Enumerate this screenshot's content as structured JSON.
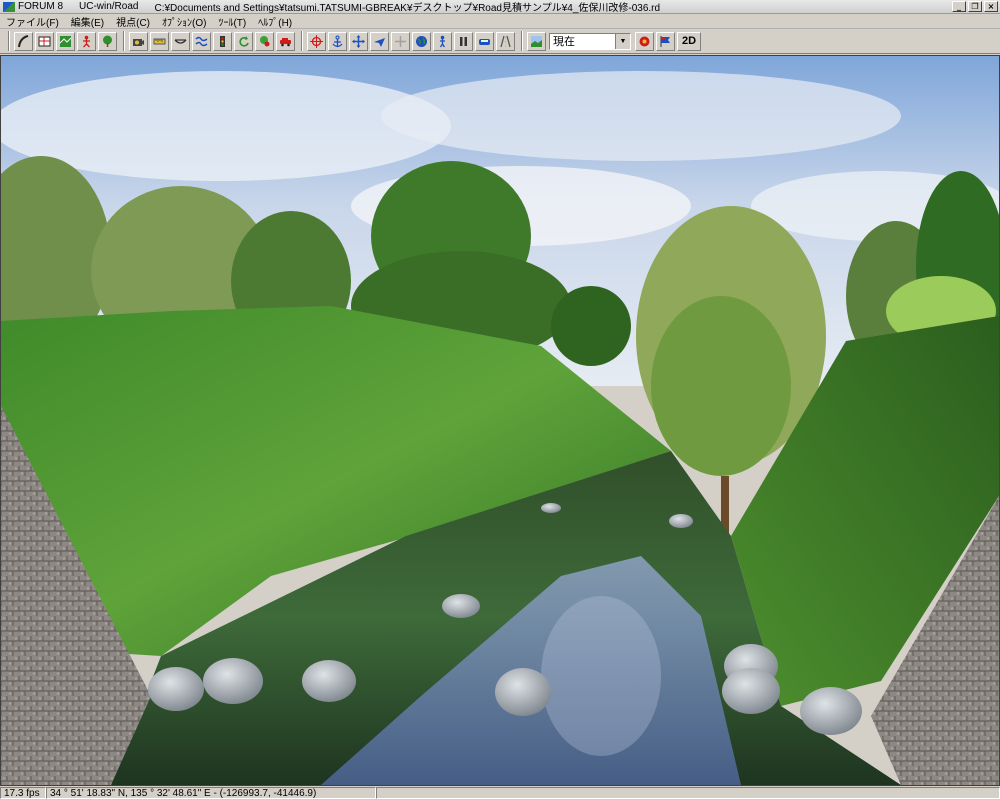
{
  "window": {
    "app_name": "FORUM 8",
    "product": "UC-win/Road",
    "file_path": "C:¥Documents and Settings¥tatsumi.TATSUMI-GBREAK¥デスクトップ¥Road見積サンプル¥4_佐保川改修-036.rd",
    "minimize": "_",
    "restore": "❐",
    "close": "×"
  },
  "menu": [
    {
      "label": "ファイル(F)"
    },
    {
      "label": "編集(E)"
    },
    {
      "label": "視点(C)"
    },
    {
      "label": "ｵﾌﾟｼｮﾝ(O)"
    },
    {
      "label": "ﾂｰﾙ(T)"
    },
    {
      "label": "ﾍﾙﾌﾟ(H)"
    }
  ],
  "toolbar": {
    "groups": [
      [
        "road-curve-icon",
        "road-grid-icon",
        "terrain-map-icon",
        "person-icon",
        "tree-icon"
      ],
      [
        "camera-icon",
        "ruler-icon",
        "bridge-icon",
        "river-icon",
        "signal-icon",
        "rotate-icon",
        "plant-icon",
        "car-icon"
      ],
      [
        "crosshair-icon",
        "anchor-icon",
        "move-icon",
        "fly-icon",
        "cursor-icon",
        "globe-icon",
        "walk-icon",
        "pause-icon",
        "vehicle-icon",
        "road-tool-icon"
      ]
    ],
    "view_select": {
      "value": "現在"
    },
    "mode_2d": "2D",
    "colors": {
      "accent_red": "#d11a1a",
      "accent_blue": "#1c4fbf",
      "accent_green": "#2f8f2f"
    }
  },
  "statusbar": {
    "fps": "17.3 fps",
    "coordinates": "34 °   51' 18.83\" N, 135 °   32' 48.61\" E  -  (-126993.7, -41446.9)"
  }
}
